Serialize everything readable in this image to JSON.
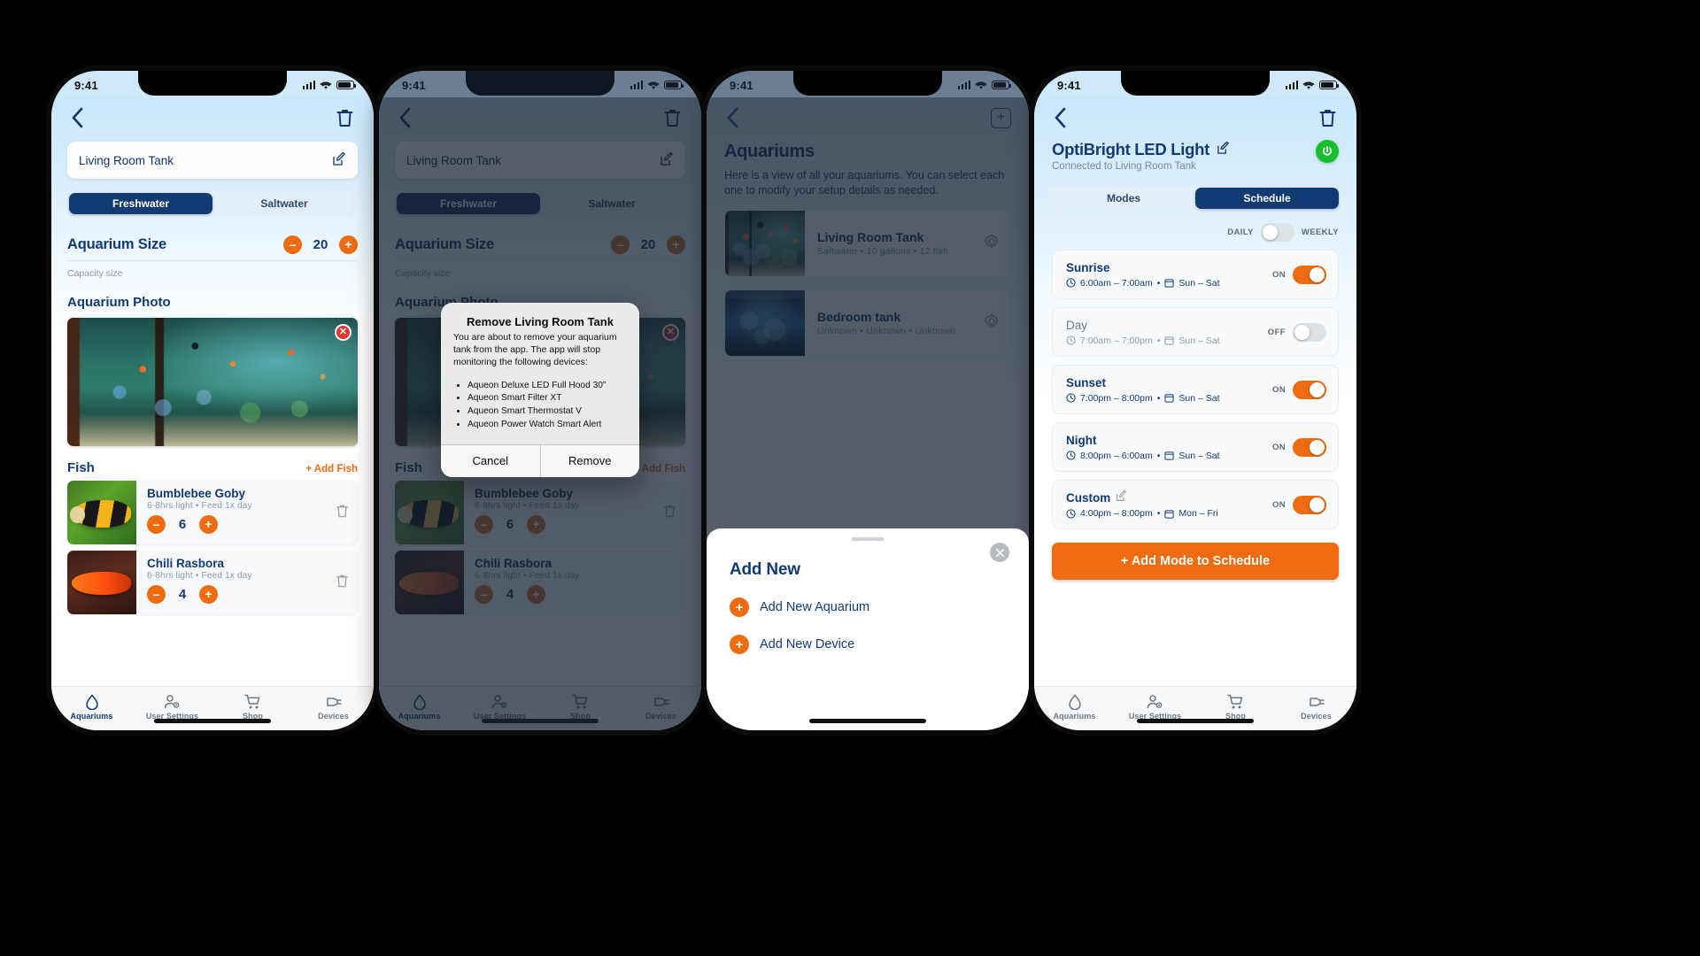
{
  "colors": {
    "accent_orange": "#ee6b10",
    "navy": "#123a73",
    "green_power": "#15c02c",
    "delete_red": "#e5342b",
    "light_blue_bg": "#c9e7fc"
  },
  "status_bar": {
    "time": "9:41",
    "signal_icon": "cellular-bars-icon",
    "wifi_icon": "wifi-icon",
    "battery_icon": "battery-icon"
  },
  "tabbar": {
    "items": [
      {
        "label": "Aquariums",
        "icon": "water-drop-icon",
        "active": true
      },
      {
        "label": "User Settings",
        "icon": "user-gear-icon",
        "active": false
      },
      {
        "label": "Shop",
        "icon": "shopping-cart-icon",
        "active": false
      },
      {
        "label": "Devices",
        "icon": "plug-icon",
        "active": false
      }
    ]
  },
  "screen1": {
    "back_icon": "chevron-left-icon",
    "delete_icon": "trash-icon",
    "tank_name": "Living Room Tank",
    "edit_icon": "edit-pencil-icon",
    "segments": [
      {
        "label": "Freshwater",
        "selected": true
      },
      {
        "label": "Saltwater",
        "selected": false
      }
    ],
    "size": {
      "title": "Aquarium Size",
      "value": "20",
      "minus": "–",
      "plus": "+",
      "caption": "Capacity size"
    },
    "photo": {
      "title": "Aquarium Photo",
      "remove_icon": "close-circle-icon"
    },
    "fish": {
      "title": "Fish",
      "add_label": "+ Add Fish",
      "items": [
        {
          "name": "Bumblebee Goby",
          "meta": "6-8hrs light • Feed 1x day",
          "count": "6",
          "art": "art-goby"
        },
        {
          "name": "Chili Rasbora",
          "meta": "6-8hrs light • Feed 1x day",
          "count": "4",
          "art": "art-rasbora"
        }
      ]
    }
  },
  "screen2": {
    "dialog": {
      "title": "Remove Living Room Tank",
      "body": "You are about to remove your aquarium tank from the app. The app will stop monitoring the following devices:",
      "devices": [
        "Aqueon Deluxe LED Full Hood 30”",
        "Aqueon Smart Filter XT",
        "Aqueon Smart Thermostat V",
        "Aqueon Power Watch Smart Alert"
      ],
      "cancel_label": "Cancel",
      "confirm_label": "Remove"
    }
  },
  "screen3": {
    "back_icon": "chevron-left-icon",
    "add_icon": "plus-box-icon",
    "title": "Aquariums",
    "subtitle": "Here is a view of all your aquariums. You can select each one to modify your setup details as needed.",
    "aquariums": [
      {
        "name": "Living Room Tank",
        "meta": "Saltwater • 10 gallons • 12 fish",
        "settings_icon": "gear-icon",
        "art": "art-tank"
      },
      {
        "name": "Bedroom tank",
        "meta": "Unknown • Unknown • Unknown",
        "settings_icon": "gear-icon",
        "art": "art-bed"
      }
    ],
    "sheet": {
      "title": "Add New",
      "close_icon": "close-circle-icon",
      "items": [
        {
          "label": "Add New Aquarium",
          "icon": "plus-circle-icon"
        },
        {
          "label": "Add New Device",
          "icon": "plus-circle-icon"
        }
      ]
    }
  },
  "screen4": {
    "back_icon": "chevron-left-icon",
    "delete_icon": "trash-icon",
    "device_name": "OptiBright LED Light",
    "edit_icon": "edit-pencil-icon",
    "connected_to": "Connected to Living Room Tank",
    "power_icon": "power-icon",
    "tabs": [
      {
        "label": "Modes",
        "selected": false
      },
      {
        "label": "Schedule",
        "selected": true
      }
    ],
    "daily_label": "DAILY",
    "weekly_label": "WEEKLY",
    "daily_weekly_state": "daily",
    "schedule": [
      {
        "name": "Sunrise",
        "time": "6:00am – 7:00am",
        "days": "Sun – Sat",
        "state_label": "ON",
        "on": true,
        "editable": false
      },
      {
        "name": "Day",
        "time": "7:00am – 7:00pm",
        "days": "Sun – Sat",
        "state_label": "OFF",
        "on": false,
        "editable": false
      },
      {
        "name": "Sunset",
        "time": "7:00pm – 8:00pm",
        "days": "Sun – Sat",
        "state_label": "ON",
        "on": true,
        "editable": false
      },
      {
        "name": "Night",
        "time": "8:00pm – 6:00am",
        "days": "Sun – Sat",
        "state_label": "ON",
        "on": true,
        "editable": false
      },
      {
        "name": "Custom",
        "time": "4:00pm – 8:00pm",
        "days": "Mon – Fri",
        "state_label": "ON",
        "on": true,
        "editable": true
      }
    ],
    "clock_icon": "clock-icon",
    "calendar_icon": "calendar-icon",
    "add_mode_label": "+ Add Mode to Schedule"
  }
}
